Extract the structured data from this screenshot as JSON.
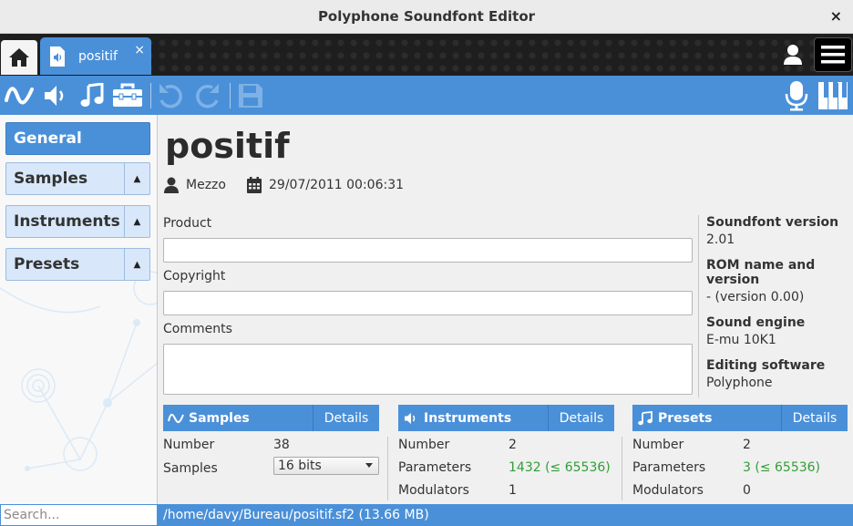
{
  "window": {
    "title": "Polyphone Soundfont Editor",
    "close_glyph": "×"
  },
  "tabs": {
    "home_icon": "home-icon",
    "file_tab_label": "positif",
    "file_tab_close": "×"
  },
  "sidebar": {
    "items": [
      {
        "label": "General",
        "active": true
      },
      {
        "label": "Samples",
        "arrow": "▲"
      },
      {
        "label": "Instruments",
        "arrow": "▲"
      },
      {
        "label": "Presets",
        "arrow": "▲"
      }
    ]
  },
  "search": {
    "placeholder": "Search..."
  },
  "status": {
    "path": "/home/davy/Bureau/positif.sf2 (13.66 MB)"
  },
  "main": {
    "title": "positif",
    "author": "Mezzo",
    "date": "29/07/2011 00:06:31",
    "fields": {
      "product_label": "Product",
      "product_value": "",
      "copyright_label": "Copyright",
      "copyright_value": "",
      "comments_label": "Comments",
      "comments_value": ""
    },
    "info": {
      "soundfont_version_label": "Soundfont version",
      "soundfont_version_value": "2.01",
      "rom_label": "ROM name and version",
      "rom_value": "- (version 0.00)",
      "engine_label": "Sound engine",
      "engine_value": "E-mu 10K1",
      "software_label": "Editing software",
      "software_value": "Polyphone"
    },
    "panels": {
      "samples": {
        "title": "Samples",
        "details": "Details",
        "number_label": "Number",
        "number_value": "38",
        "samples_label": "Samples",
        "bits_selected": "16 bits"
      },
      "instruments": {
        "title": "Instruments",
        "details": "Details",
        "number_label": "Number",
        "number_value": "2",
        "parameters_label": "Parameters",
        "parameters_value": "1432 (≤ 65536)",
        "modulators_label": "Modulators",
        "modulators_value": "1"
      },
      "presets": {
        "title": "Presets",
        "details": "Details",
        "number_label": "Number",
        "number_value": "2",
        "parameters_label": "Parameters",
        "parameters_value": "3 (≤ 65536)",
        "modulators_label": "Modulators",
        "modulators_value": "0"
      }
    }
  },
  "colors": {
    "accent": "#4a90d9",
    "ok_green": "#2f9f36",
    "tabbar": "#1e1e1e"
  }
}
